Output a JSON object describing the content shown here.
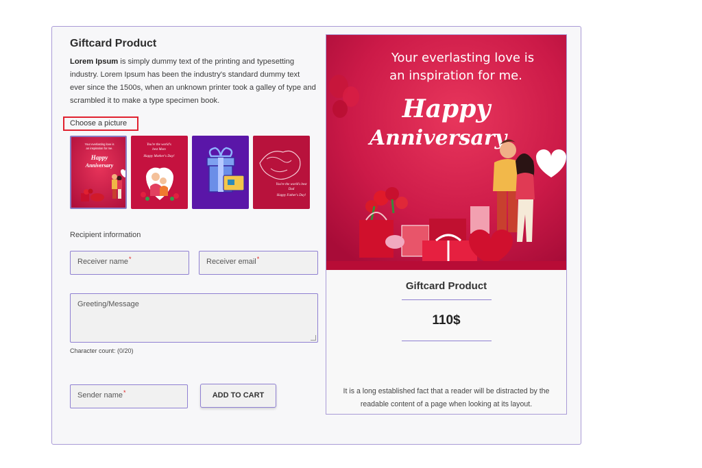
{
  "product": {
    "title": "Giftcard Product",
    "desc_bold": "Lorem Ipsum",
    "desc_rest": " is simply dummy text of the printing and typesetting industry. Lorem Ipsum has been the industry's standard dummy text ever since the 1500s, when an unknown printer took a galley of type and scrambled it to make a type specimen book."
  },
  "picker": {
    "label": "Choose a picture",
    "thumbs": [
      {
        "line1": "Your everlasting love is",
        "line2": "an inspiration for me.",
        "script1": "Happy",
        "script2": "Anniversary"
      },
      {
        "line1": "You're the world's",
        "line2": "best Mom",
        "script1": "Happy Mother's Day!"
      },
      {
        "line1": "",
        "line2": ""
      },
      {
        "line1": "You're the world's best",
        "line2": "Dad",
        "script1": "Happy Father's Day!"
      }
    ]
  },
  "form": {
    "section_label": "Recipient information",
    "receiver_name": "Receiver name",
    "receiver_email": "Receiver email",
    "message": "Greeting/Message",
    "char_count": "Character count: (0/20)",
    "sender_name": "Sender name",
    "required_mark": "*",
    "add_to_cart": "ADD TO CART"
  },
  "preview": {
    "card_line1": "Your everlasting love is",
    "card_line2": "an inspiration for me.",
    "card_script1": "Happy",
    "card_script2": "Anniversary",
    "title": "Giftcard Product",
    "price": "110$",
    "footer": "It is a long established fact that a reader will be distracted by the readable content of a page when looking at its layout."
  },
  "colors": {
    "accent": "#8e7fd1",
    "highlight": "#e0202e",
    "card_red": "#d01a4c",
    "gift_purple": "#5a16a8"
  }
}
